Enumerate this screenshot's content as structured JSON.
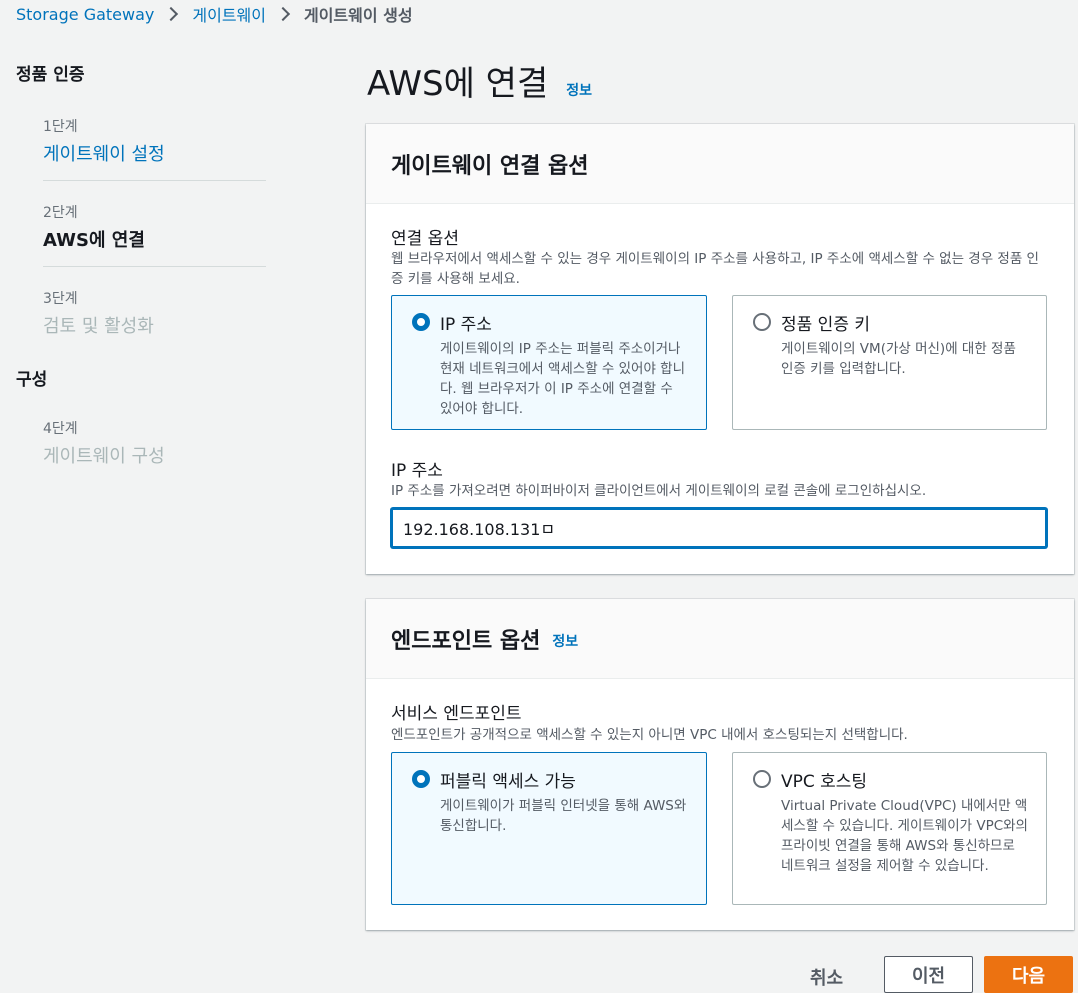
{
  "breadcrumb": {
    "items": [
      "Storage Gateway",
      "게이트웨이",
      "게이트웨이 생성"
    ]
  },
  "sidebar": {
    "section_activation": "정품 인증",
    "section_config": "구성",
    "steps": [
      {
        "num": "1단계",
        "label": "게이트웨이 설정",
        "state": "link"
      },
      {
        "num": "2단계",
        "label": "AWS에 연결",
        "state": "current"
      },
      {
        "num": "3단계",
        "label": "검토 및 활성화",
        "state": "disabled"
      },
      {
        "num": "4단계",
        "label": "게이트웨이 구성",
        "state": "disabled"
      }
    ]
  },
  "page": {
    "title": "AWS에 연결",
    "info": "정보"
  },
  "connection_panel": {
    "header": "게이트웨이 연결 옵션",
    "option_label": "연결 옵션",
    "option_desc": "웹 브라우저에서 액세스할 수 있는 경우 게이트웨이의 IP 주소를 사용하고, IP 주소에 액세스할 수 없는 경우 정품 인증 키를 사용해 보세요.",
    "tiles": [
      {
        "title": "IP 주소",
        "desc": "게이트웨이의 IP 주소는 퍼블릭 주소이거나 현재 네트워크에서 액세스할 수 있어야 합니다. 웹 브라우저가 이 IP 주소에 연결할 수 있어야 합니다.",
        "selected": true
      },
      {
        "title": "정품 인증 키",
        "desc": "게이트웨이의 VM(가상 머신)에 대한 정품 인증 키를 입력합니다.",
        "selected": false
      }
    ],
    "ip_label": "IP 주소",
    "ip_desc": "IP 주소를 가져오려면 하이퍼바이저 클라이언트에서 게이트웨이의 로컬 콘솔에 로그인하십시오.",
    "ip_value": "192.168.108.131ㅁ"
  },
  "endpoint_panel": {
    "header": "엔드포인트 옵션",
    "info": "정보",
    "service_label": "서비스 엔드포인트",
    "service_desc": "엔드포인트가 공개적으로 액세스할 수 있는지 아니면 VPC 내에서 호스팅되는지 선택합니다.",
    "tiles": [
      {
        "title": "퍼블릭 액세스 가능",
        "desc": "게이트웨이가 퍼블릭 인터넷을 통해 AWS와 통신합니다.",
        "selected": true
      },
      {
        "title": "VPC 호스팅",
        "desc": "Virtual Private Cloud(VPC) 내에서만 액세스할 수 있습니다. 게이트웨이가 VPC와의 프라이빗 연결을 통해 AWS와 통신하므로 네트워크 설정을 제어할 수 있습니다.",
        "selected": false
      }
    ]
  },
  "actions": {
    "cancel": "취소",
    "previous": "이전",
    "next": "다음"
  },
  "colors": {
    "link": "#0073bb",
    "primary_button": "#ec7211",
    "selected_tile_bg": "#f1faff"
  }
}
